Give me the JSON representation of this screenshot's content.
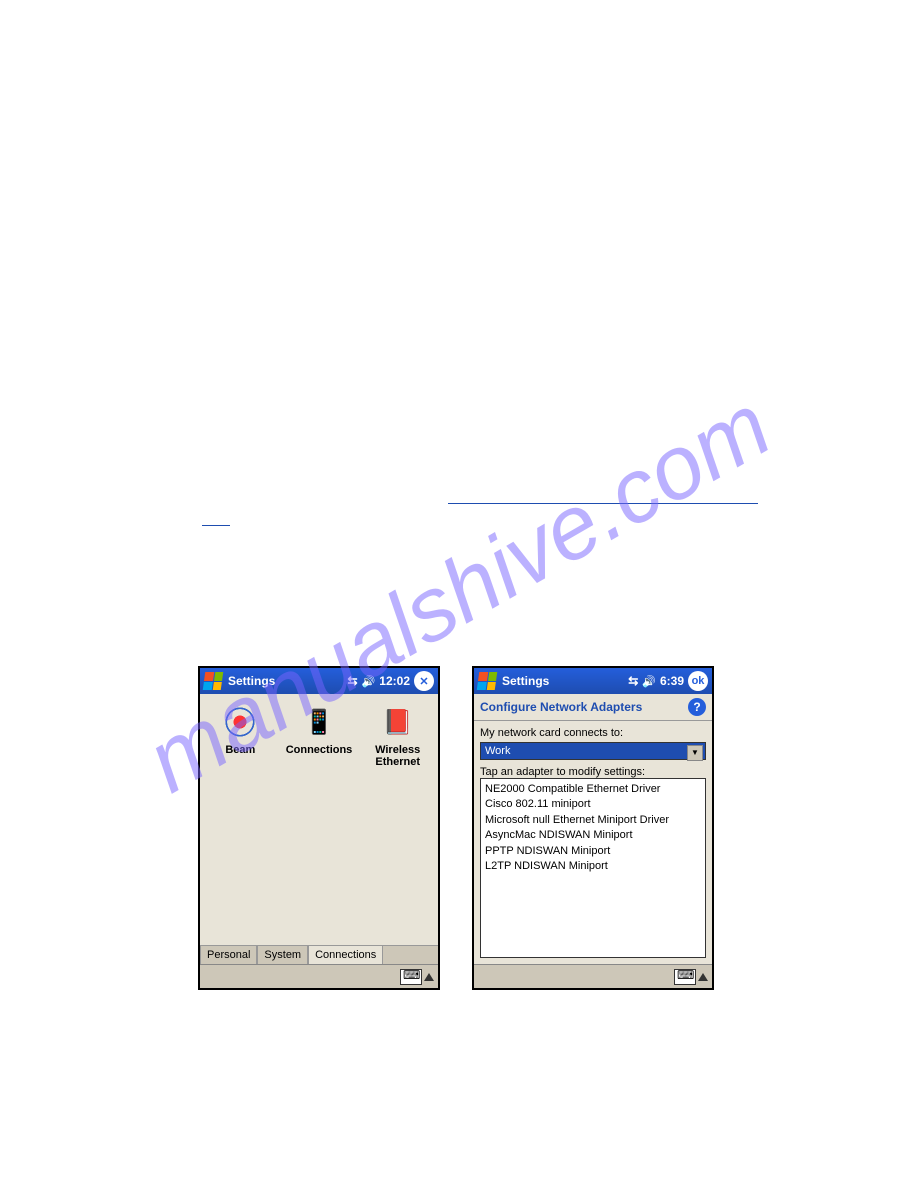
{
  "watermark": "manualshive.com",
  "left": {
    "title": "Settings",
    "time": "12:02",
    "close": "✕",
    "icons": [
      {
        "name": "beam",
        "label": "Beam"
      },
      {
        "name": "connections",
        "label": "Connections"
      },
      {
        "name": "wireless-ethernet",
        "label": "Wireless Ethernet"
      }
    ],
    "tabs": [
      "Personal",
      "System",
      "Connections"
    ],
    "active_tab": 2
  },
  "right": {
    "title": "Settings",
    "time": "6:39",
    "ok": "ok",
    "subheader": "Configure Network Adapters",
    "help": "?",
    "label1": "My network card connects to:",
    "dropdown_value": "Work",
    "label2": "Tap an adapter to modify settings:",
    "adapters": [
      "NE2000 Compatible Ethernet Driver",
      "Cisco 802.11 miniport",
      "Microsoft null Ethernet Miniport Driver",
      "AsyncMac NDISWAN Miniport",
      "PPTP NDISWAN Miniport",
      "L2TP NDISWAN Miniport"
    ]
  }
}
